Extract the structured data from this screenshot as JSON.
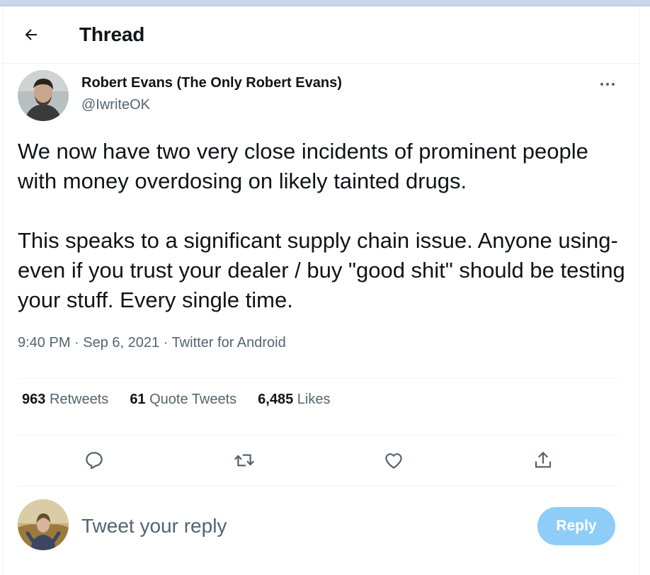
{
  "header": {
    "title": "Thread",
    "back_icon": "arrow-left-icon"
  },
  "tweet": {
    "author_name": "Robert Evans (The Only Robert Evans)",
    "author_handle": "@IwriteOK",
    "more_icon": "more-horizontal-icon",
    "paragraph_1": "We now have two very close incidents of prominent people with money overdosing on likely tainted drugs.",
    "paragraph_2": "This speaks to a significant supply chain issue. Anyone using- even if you trust your dealer / buy \"good shit\" should be testing your stuff. Every single time.",
    "time": "9:40 PM",
    "date": "Sep 6, 2021",
    "source": "Twitter for Android",
    "separator": " · "
  },
  "stats": {
    "retweets_count": "963",
    "retweets_label": "Retweets",
    "quotes_count": "61",
    "quotes_label": "Quote Tweets",
    "likes_count": "6,485",
    "likes_label": "Likes"
  },
  "actions": {
    "reply_icon": "reply-bubble-icon",
    "retweet_icon": "retweet-icon",
    "like_icon": "heart-icon",
    "share_icon": "share-icon"
  },
  "reply_box": {
    "placeholder": "Tweet your reply",
    "button_label": "Reply"
  },
  "colors": {
    "text_primary": "#0f1419",
    "text_secondary": "#536471",
    "reply_button_disabled": "#8ecdf7",
    "divider": "#eff3f4"
  }
}
